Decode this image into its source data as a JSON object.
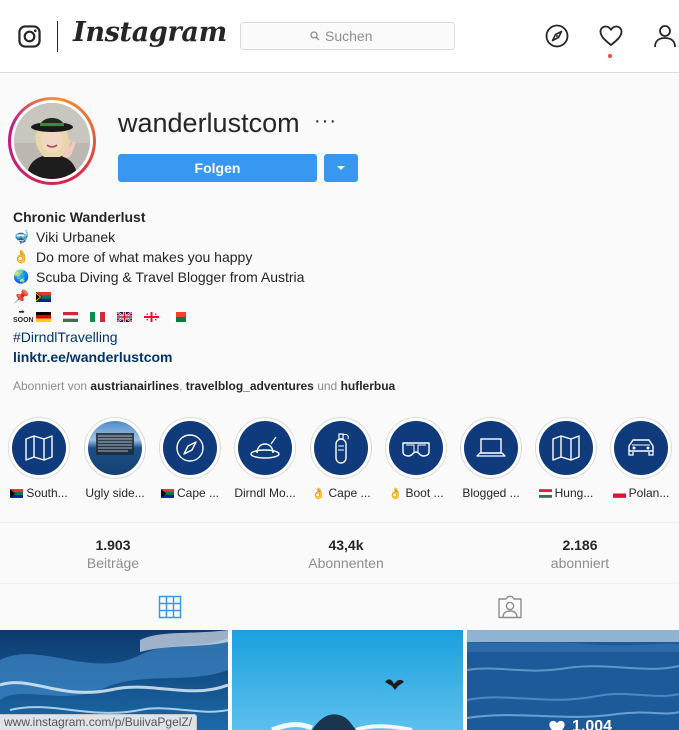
{
  "nav": {
    "wordmark": "Instagram",
    "search_placeholder": "Suchen"
  },
  "profile": {
    "username": "wanderlustcom",
    "more": "···",
    "follow_label": "Folgen",
    "bio": {
      "name": "Chronic Wanderlust",
      "line1": "Viki Urbanek",
      "line2": "Do more of what makes you happy",
      "line3": "Scuba Diving & Travel Blogger from Austria",
      "soon": "SOON",
      "hashtag": "#DirndlTravelling",
      "link": "linktr.ee/wanderlustcom"
    },
    "followed_by": {
      "prefix": "Abonniert von",
      "user1": "austrianairlines",
      "user2": "travelblog_adventures",
      "conj": "und",
      "user3": "huflerbua"
    }
  },
  "highlights": [
    {
      "label": "South...",
      "icon": "map"
    },
    {
      "label": "Ugly side...",
      "icon": "photo"
    },
    {
      "label": "Cape ...",
      "icon": "compass"
    },
    {
      "label": "Dirndl Mo...",
      "icon": "hat"
    },
    {
      "label": "Cape ...",
      "icon": "scuba-tank"
    },
    {
      "label": "Boot ...",
      "icon": "dive-mask"
    },
    {
      "label": "Blogged ...",
      "icon": "laptop"
    },
    {
      "label": "Hung...",
      "icon": "map"
    },
    {
      "label": "Polan...",
      "icon": "car"
    }
  ],
  "stats": {
    "posts": {
      "value": "1.903",
      "label": "Beiträge"
    },
    "followers": {
      "value": "43,4k",
      "label": "Abonnenten"
    },
    "following": {
      "value": "2.186",
      "label": "abonniert"
    }
  },
  "tabs": [
    "grid",
    "tagged"
  ],
  "grid": {
    "likes": "1.004"
  },
  "status_url": "www.instagram.com/p/BuiivaPgelZ/",
  "colors": {
    "accent": "#3897f0",
    "highlight_bg": "#0f3b7d",
    "link": "#003569"
  }
}
